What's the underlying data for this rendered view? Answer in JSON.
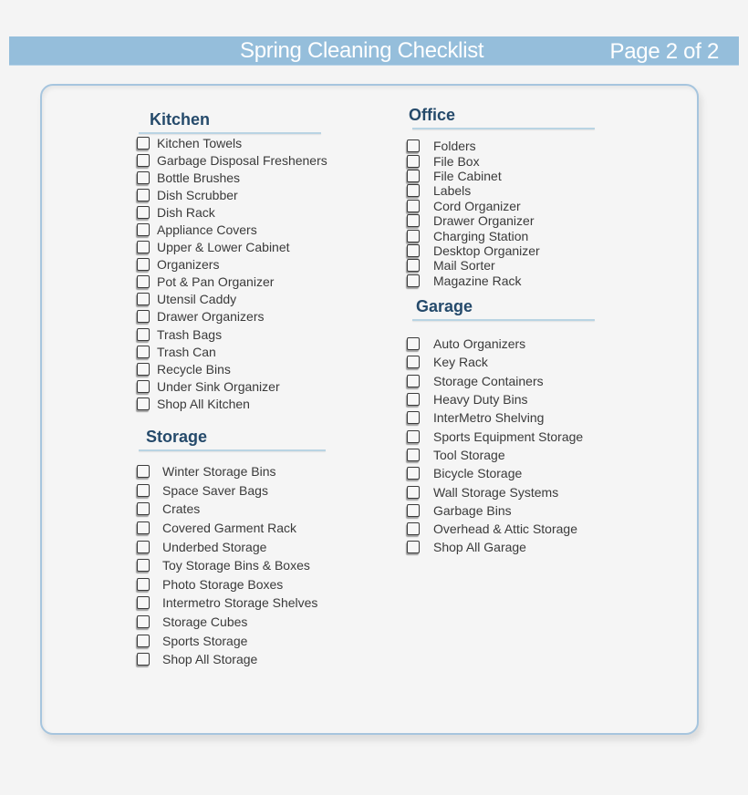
{
  "header": {
    "title": "Spring Cleaning Checklist",
    "page_indicator": "Page 2 of 2"
  },
  "colors": {
    "header_bar": "#95bedb",
    "section_title": "#254a6b",
    "panel_border": "#a6c5de",
    "section_rule": "#b9d4e3"
  },
  "sections": {
    "kitchen": {
      "title": "Kitchen",
      "items": [
        "Kitchen Towels",
        "Garbage Disposal Fresheners",
        "Bottle Brushes",
        "Dish Scrubber",
        "Dish Rack",
        "Appliance Covers",
        "Upper & Lower Cabinet",
        "Organizers",
        "Pot & Pan Organizer",
        "Utensil Caddy",
        "Drawer Organizers",
        "Trash Bags",
        "Trash Can",
        "Recycle Bins",
        "Under Sink Organizer",
        "Shop All Kitchen"
      ]
    },
    "storage": {
      "title": "Storage",
      "items": [
        "Winter Storage Bins",
        "Space Saver Bags",
        "Crates",
        "Covered Garment Rack",
        "Underbed Storage",
        "Toy Storage Bins & Boxes",
        "Photo Storage Boxes",
        "Intermetro Storage Shelves",
        "Storage Cubes",
        "Sports Storage",
        "Shop All Storage"
      ]
    },
    "office": {
      "title": "Office",
      "items": [
        "Folders",
        "File Box",
        "File Cabinet",
        "Labels",
        "Cord Organizer",
        "Drawer Organizer",
        "Charging Station",
        "Desktop Organizer",
        "Mail Sorter",
        "Magazine Rack"
      ]
    },
    "garage": {
      "title": "Garage",
      "items": [
        "Auto Organizers",
        "Key Rack",
        "Storage Containers",
        "Heavy Duty Bins",
        "InterMetro Shelving",
        "Sports Equipment Storage",
        "Tool Storage",
        "Bicycle Storage",
        "Wall Storage Systems",
        "Garbage Bins",
        "Overhead & Attic Storage",
        "Shop All Garage"
      ]
    }
  }
}
